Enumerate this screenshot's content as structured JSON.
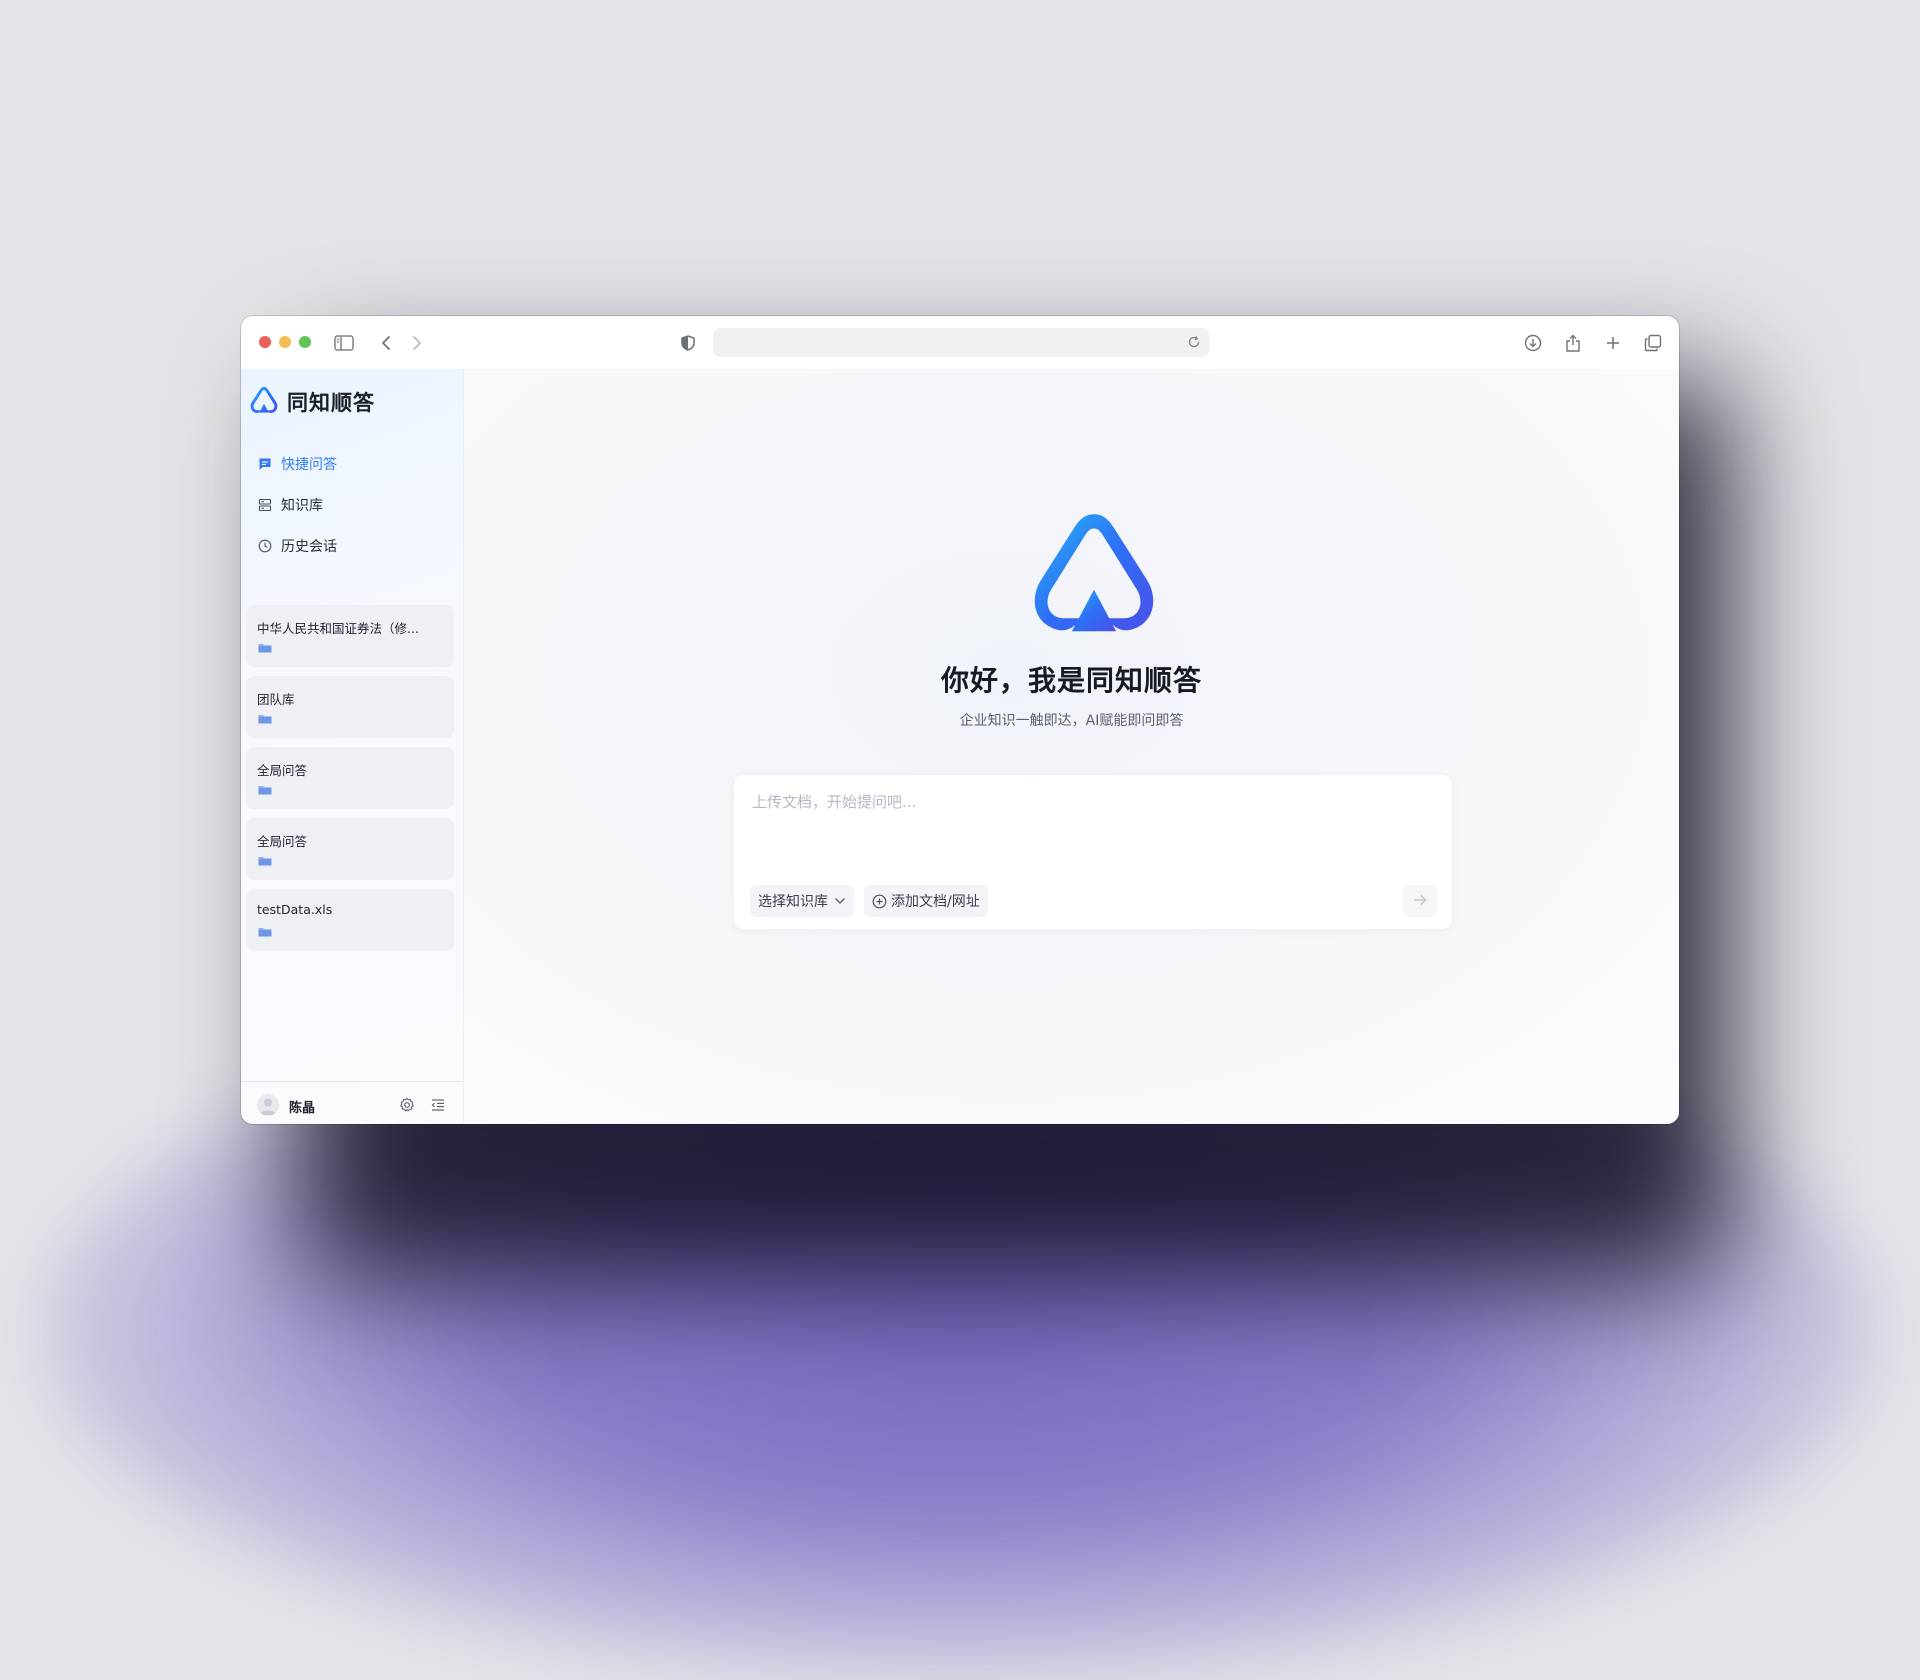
{
  "app": {
    "name": "同知顺答"
  },
  "sidebar": {
    "nav": [
      {
        "label": "快捷问答",
        "icon": "chat-icon",
        "active": true
      },
      {
        "label": "知识库",
        "icon": "database-icon",
        "active": false
      },
      {
        "label": "历史会话",
        "icon": "clock-icon",
        "active": false
      }
    ],
    "sessions": [
      {
        "title": "中华人民共和国证券法（修...",
        "icon": "folder-icon"
      },
      {
        "title": "团队库",
        "icon": "folder-icon"
      },
      {
        "title": "全局问答",
        "icon": "folder-icon"
      },
      {
        "title": "全局问答",
        "icon": "folder-icon"
      },
      {
        "title": "testData.xls",
        "icon": "folder-icon"
      }
    ],
    "user": {
      "name": "陈晶"
    }
  },
  "main": {
    "greeting": "你好，我是同知顺答",
    "subtitle": "企业知识一触即达，AI赋能即问即答",
    "input_placeholder": "上传文档，开始提问吧...",
    "select_kb_label": "选择知识库",
    "add_doc_label": "添加文档/网址"
  },
  "colors": {
    "accent": "#2f7cf6",
    "logo_gradient": [
      "#27b6f4",
      "#2e6ff5",
      "#4b4fe8"
    ]
  }
}
